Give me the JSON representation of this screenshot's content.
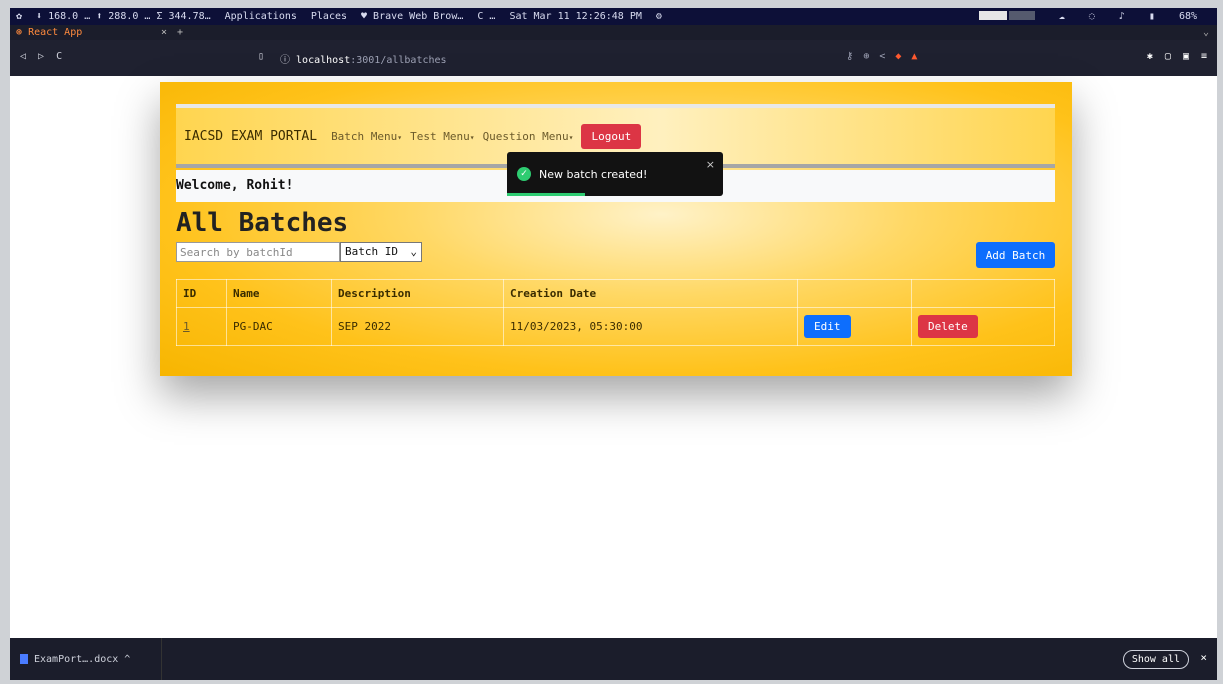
{
  "system": {
    "stat1": "⬇ 168.0 … ⬆ 288.0 … Σ 344.78…",
    "menu_apps": "Applications",
    "menu_places": "Places",
    "app_title": "♥ Brave Web Brow…",
    "loading": "C …",
    "clock": "Sat Mar 11 12:26:48 PM",
    "battery": "68%"
  },
  "browser": {
    "tab_title": "React App",
    "url_host": "localhost",
    "url_path": ":3001/allbatches"
  },
  "app": {
    "brand": "IACSD EXAM PORTAL",
    "menus": [
      "Batch Menu",
      "Test Menu",
      "Question Menu"
    ],
    "logout": "Logout",
    "welcome": "Welcome, Rohit!",
    "heading": "All Batches",
    "search_placeholder": "Search by batchId",
    "filter_selected": "Batch ID",
    "add_batch": "Add Batch",
    "table": {
      "headers": [
        "ID",
        "Name",
        "Description",
        "Creation Date"
      ],
      "rows": [
        {
          "id": "1",
          "name": "PG-DAC",
          "description": "SEP 2022",
          "created": "11/03/2023, 05:30:00"
        }
      ],
      "edit_label": "Edit",
      "delete_label": "Delete"
    }
  },
  "toast": {
    "message": "New batch created!",
    "close": "×"
  },
  "downloads": {
    "file": "ExamPort….docx",
    "show_all": "Show all",
    "close": "×"
  },
  "colors": {
    "accent_yellow": "#ffc21a",
    "primary": "#0d6efd",
    "danger": "#dc3545",
    "success": "#2ecc71"
  }
}
